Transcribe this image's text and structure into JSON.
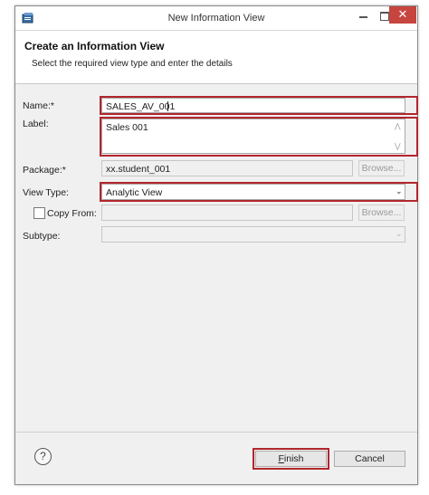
{
  "window": {
    "title": "New Information View",
    "minimize_icon": "minimize-icon",
    "maximize_icon": "maximize-icon",
    "close_icon": "close-icon"
  },
  "header": {
    "title": "Create an Information View",
    "description": "Select the required view type and enter the details"
  },
  "form": {
    "name_label": "Name:*",
    "name_value": "SALES_AV_001",
    "label_label": "Label:",
    "label_value": "Sales 001",
    "package_label": "Package:*",
    "package_value": "xx.student_001",
    "package_browse": "Browse...",
    "view_type_label": "View Type:",
    "view_type_value": "Analytic View",
    "copy_from_label": "Copy From:",
    "copy_from_value": "",
    "copy_from_browse": "Browse...",
    "subtype_label": "Subtype:",
    "subtype_value": ""
  },
  "footer": {
    "help_icon": "help-icon",
    "finish_mnemonic": "F",
    "finish_rest": "inish",
    "cancel_label": "Cancel"
  },
  "colors": {
    "highlight": "#b3262d",
    "close_button": "#c7453f"
  }
}
